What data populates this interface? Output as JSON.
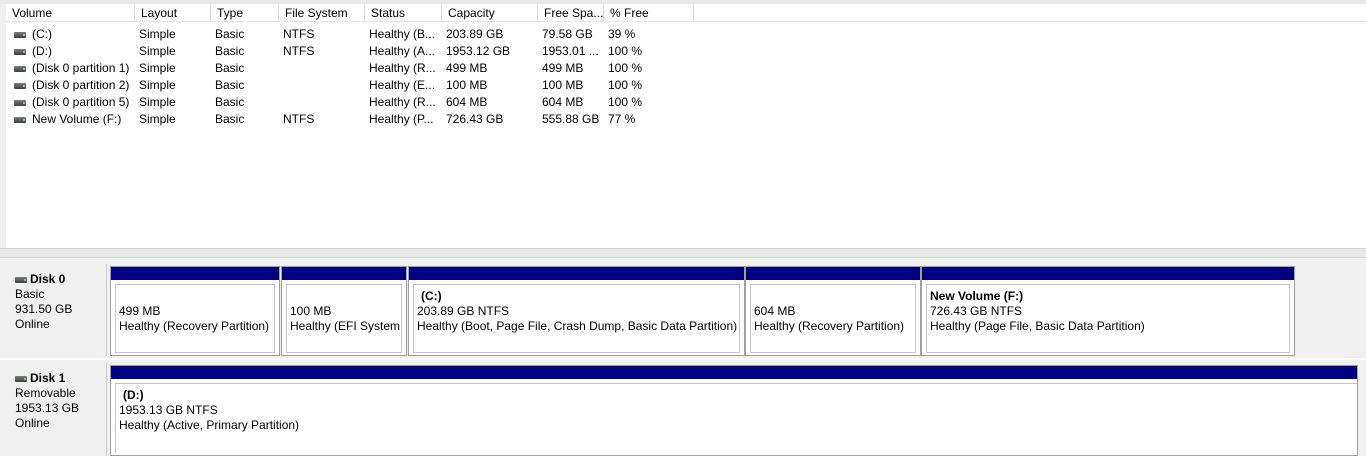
{
  "columns": [
    "Volume",
    "Layout",
    "Type",
    "File System",
    "Status",
    "Capacity",
    "Free Spa...",
    "% Free"
  ],
  "volumes": [
    {
      "name": "(C:)",
      "layout": "Simple",
      "type": "Basic",
      "fs": "NTFS",
      "status": "Healthy (B...",
      "capacity": "203.89 GB",
      "free": "79.58 GB",
      "pct": "39 %"
    },
    {
      "name": "(D:)",
      "layout": "Simple",
      "type": "Basic",
      "fs": "NTFS",
      "status": "Healthy (A...",
      "capacity": "1953.12 GB",
      "free": "1953.01 ...",
      "pct": "100 %"
    },
    {
      "name": "(Disk 0 partition 1)",
      "layout": "Simple",
      "type": "Basic",
      "fs": "",
      "status": "Healthy (R...",
      "capacity": "499 MB",
      "free": "499 MB",
      "pct": "100 %"
    },
    {
      "name": "(Disk 0 partition 2)",
      "layout": "Simple",
      "type": "Basic",
      "fs": "",
      "status": "Healthy (E...",
      "capacity": "100 MB",
      "free": "100 MB",
      "pct": "100 %"
    },
    {
      "name": "(Disk 0 partition 5)",
      "layout": "Simple",
      "type": "Basic",
      "fs": "",
      "status": "Healthy (R...",
      "capacity": "604 MB",
      "free": "604 MB",
      "pct": "100 %"
    },
    {
      "name": "New Volume (F:)",
      "layout": "Simple",
      "type": "Basic",
      "fs": "NTFS",
      "status": "Healthy (P...",
      "capacity": "726.43 GB",
      "free": "555.88 GB",
      "pct": "77 %"
    }
  ],
  "disks": [
    {
      "title": "Disk 0",
      "kind": "Basic",
      "size": "931.50 GB",
      "state": "Online",
      "partitions": [
        {
          "name": "",
          "size": "499 MB",
          "status": "Healthy (Recovery Partition)"
        },
        {
          "name": "",
          "size": "100 MB",
          "status": "Healthy (EFI System P"
        },
        {
          "name": "(C:)",
          "size": "203.89 GB NTFS",
          "status": "Healthy (Boot, Page File, Crash Dump, Basic Data Partition)"
        },
        {
          "name": "",
          "size": "604 MB",
          "status": "Healthy (Recovery Partition)"
        },
        {
          "name": "New Volume  (F:)",
          "size": "726.43 GB NTFS",
          "status": "Healthy (Page File, Basic Data Partition)"
        }
      ]
    },
    {
      "title": "Disk 1",
      "kind": "Removable",
      "size": "1953.13 GB",
      "state": "Online",
      "partitions": [
        {
          "name": "(D:)",
          "size": "1953.13 GB NTFS",
          "status": "Healthy (Active, Primary Partition)"
        }
      ]
    }
  ],
  "colors": {
    "partition_bar": "#000080"
  },
  "icons": {
    "volume": "drive-icon",
    "disk": "disk-icon"
  }
}
